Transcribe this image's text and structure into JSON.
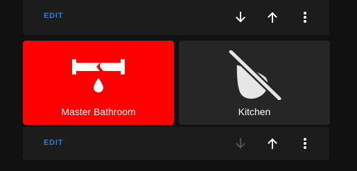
{
  "top_card": {
    "edit_label": "EDIT"
  },
  "tiles": [
    {
      "label": "Master Bathroom",
      "icon": "pipe-leak-icon",
      "state": "alert",
      "color": "#ff0000"
    },
    {
      "label": "Kitchen",
      "icon": "water-off-icon",
      "state": "off",
      "color": "#262626"
    }
  ],
  "bottom_card": {
    "edit_label": "EDIT",
    "move_down_disabled": true
  },
  "colors": {
    "accent": "#2e7bd6",
    "alert": "#ff0000",
    "card": "#1c1c1c",
    "background": "#111111"
  }
}
